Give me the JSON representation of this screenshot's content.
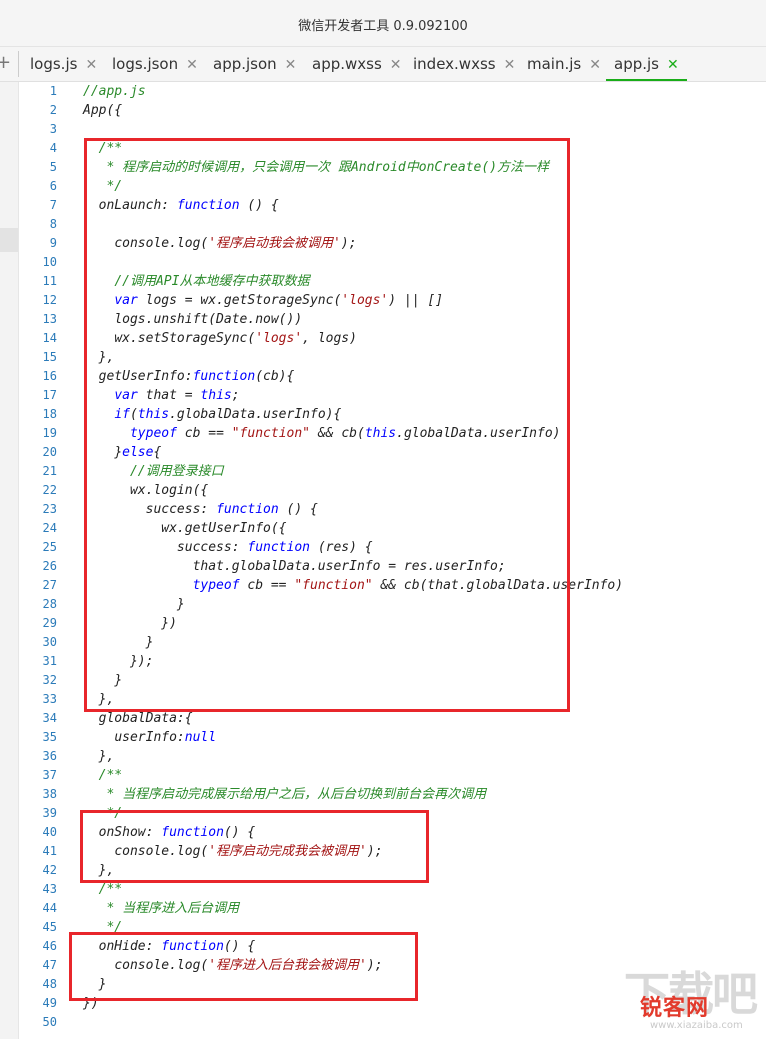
{
  "window": {
    "title": "微信开发者工具 0.9.092100"
  },
  "toolbar": {
    "add_tab_label": "+"
  },
  "tabs": [
    {
      "label": "logs.js",
      "close": "✕",
      "active": false
    },
    {
      "label": "logs.json",
      "close": "✕",
      "active": false
    },
    {
      "label": "app.json",
      "close": "✕",
      "active": false
    },
    {
      "label": "app.wxss",
      "close": "✕",
      "active": false
    },
    {
      "label": "index.wxss",
      "close": "✕",
      "active": false
    },
    {
      "label": "main.js",
      "close": "✕",
      "active": false
    },
    {
      "label": "app.js",
      "close": "✕",
      "active": true
    }
  ],
  "editor": {
    "lines": [
      {
        "n": "1",
        "indent": "",
        "segs": [
          [
            "//app.js",
            "comment"
          ]
        ]
      },
      {
        "n": "2",
        "indent": "",
        "segs": [
          [
            "App({",
            "plain"
          ]
        ]
      },
      {
        "n": "3",
        "indent": "",
        "segs": []
      },
      {
        "n": "4",
        "indent": "  ",
        "segs": [
          [
            "/**",
            "comment"
          ]
        ]
      },
      {
        "n": "5",
        "indent": "   ",
        "segs": [
          [
            "* 程序启动的时候调用，只会调用一次 跟Android中onCreate()方法一样",
            "comment"
          ]
        ]
      },
      {
        "n": "6",
        "indent": "   ",
        "segs": [
          [
            "*/",
            "comment"
          ]
        ]
      },
      {
        "n": "7",
        "indent": "  ",
        "segs": [
          [
            "onLaunch: ",
            "plain"
          ],
          [
            "function",
            "kw"
          ],
          [
            " () {",
            "plain"
          ]
        ]
      },
      {
        "n": "8",
        "indent": "",
        "segs": []
      },
      {
        "n": "9",
        "indent": "    ",
        "segs": [
          [
            "console.log(",
            "plain"
          ],
          [
            "'程序启动我会被调用'",
            "str"
          ],
          [
            ");",
            "plain"
          ]
        ]
      },
      {
        "n": "10",
        "indent": "",
        "segs": []
      },
      {
        "n": "11",
        "indent": "    ",
        "segs": [
          [
            "//调用API从本地缓存中获取数据",
            "comment"
          ]
        ]
      },
      {
        "n": "12",
        "indent": "    ",
        "segs": [
          [
            "var",
            "kw"
          ],
          [
            " logs = wx.getStorageSync(",
            "plain"
          ],
          [
            "'logs'",
            "str"
          ],
          [
            ") || []",
            "plain"
          ]
        ]
      },
      {
        "n": "13",
        "indent": "    ",
        "segs": [
          [
            "logs.unshift(Date.now())",
            "plain"
          ]
        ]
      },
      {
        "n": "14",
        "indent": "    ",
        "segs": [
          [
            "wx.setStorageSync(",
            "plain"
          ],
          [
            "'logs'",
            "str"
          ],
          [
            ", logs)",
            "plain"
          ]
        ]
      },
      {
        "n": "15",
        "indent": "  ",
        "segs": [
          [
            "},",
            "plain"
          ]
        ]
      },
      {
        "n": "16",
        "indent": "  ",
        "segs": [
          [
            "getUserInfo:",
            "plain"
          ],
          [
            "function",
            "kw"
          ],
          [
            "(cb){",
            "plain"
          ]
        ]
      },
      {
        "n": "17",
        "indent": "    ",
        "segs": [
          [
            "var",
            "kw"
          ],
          [
            " that = ",
            "plain"
          ],
          [
            "this",
            "kw"
          ],
          [
            ";",
            "plain"
          ]
        ]
      },
      {
        "n": "18",
        "indent": "    ",
        "segs": [
          [
            "if",
            "kw"
          ],
          [
            "(",
            "plain"
          ],
          [
            "this",
            "kw"
          ],
          [
            ".globalData.userInfo){",
            "plain"
          ]
        ]
      },
      {
        "n": "19",
        "indent": "      ",
        "segs": [
          [
            "typeof",
            "kw"
          ],
          [
            " cb == ",
            "plain"
          ],
          [
            "\"function\"",
            "str"
          ],
          [
            " && cb(",
            "plain"
          ],
          [
            "this",
            "kw"
          ],
          [
            ".globalData.userInfo)",
            "plain"
          ]
        ]
      },
      {
        "n": "20",
        "indent": "    ",
        "segs": [
          [
            "}",
            "plain"
          ],
          [
            "else",
            "kw"
          ],
          [
            "{",
            "plain"
          ]
        ]
      },
      {
        "n": "21",
        "indent": "      ",
        "segs": [
          [
            "//调用登录接口",
            "comment"
          ]
        ]
      },
      {
        "n": "22",
        "indent": "      ",
        "segs": [
          [
            "wx.login({",
            "plain"
          ]
        ]
      },
      {
        "n": "23",
        "indent": "        ",
        "segs": [
          [
            "success: ",
            "plain"
          ],
          [
            "function",
            "kw"
          ],
          [
            " () {",
            "plain"
          ]
        ]
      },
      {
        "n": "24",
        "indent": "          ",
        "segs": [
          [
            "wx.getUserInfo({",
            "plain"
          ]
        ]
      },
      {
        "n": "25",
        "indent": "            ",
        "segs": [
          [
            "success: ",
            "plain"
          ],
          [
            "function",
            "kw"
          ],
          [
            " (res) {",
            "plain"
          ]
        ]
      },
      {
        "n": "26",
        "indent": "              ",
        "segs": [
          [
            "that.globalData.userInfo = res.userInfo;",
            "plain"
          ]
        ]
      },
      {
        "n": "27",
        "indent": "              ",
        "segs": [
          [
            "typeof",
            "kw"
          ],
          [
            " cb == ",
            "plain"
          ],
          [
            "\"function\"",
            "str"
          ],
          [
            " && cb(that.globalData.userInfo)",
            "plain"
          ]
        ]
      },
      {
        "n": "28",
        "indent": "            ",
        "segs": [
          [
            "}",
            "plain"
          ]
        ]
      },
      {
        "n": "29",
        "indent": "          ",
        "segs": [
          [
            "})",
            "plain"
          ]
        ]
      },
      {
        "n": "30",
        "indent": "        ",
        "segs": [
          [
            "}",
            "plain"
          ]
        ]
      },
      {
        "n": "31",
        "indent": "      ",
        "segs": [
          [
            "});",
            "plain"
          ]
        ]
      },
      {
        "n": "32",
        "indent": "    ",
        "segs": [
          [
            "}",
            "plain"
          ]
        ]
      },
      {
        "n": "33",
        "indent": "  ",
        "segs": [
          [
            "},",
            "plain"
          ]
        ]
      },
      {
        "n": "34",
        "indent": "  ",
        "segs": [
          [
            "globalData:{",
            "plain"
          ]
        ]
      },
      {
        "n": "35",
        "indent": "    ",
        "segs": [
          [
            "userInfo:",
            "plain"
          ],
          [
            "null",
            "kw"
          ]
        ]
      },
      {
        "n": "36",
        "indent": "  ",
        "segs": [
          [
            "},",
            "plain"
          ]
        ]
      },
      {
        "n": "37",
        "indent": "  ",
        "segs": [
          [
            "/**",
            "comment"
          ]
        ]
      },
      {
        "n": "38",
        "indent": "   ",
        "segs": [
          [
            "* 当程序启动完成展示给用户之后，从后台切换到前台会再次调用",
            "comment"
          ]
        ]
      },
      {
        "n": "39",
        "indent": "   ",
        "segs": [
          [
            "*/",
            "comment"
          ]
        ]
      },
      {
        "n": "40",
        "indent": "  ",
        "segs": [
          [
            "onShow: ",
            "plain"
          ],
          [
            "function",
            "kw"
          ],
          [
            "() {",
            "plain"
          ]
        ]
      },
      {
        "n": "41",
        "indent": "    ",
        "segs": [
          [
            "console.log(",
            "plain"
          ],
          [
            "'程序启动完成我会被调用'",
            "str"
          ],
          [
            ");",
            "plain"
          ]
        ]
      },
      {
        "n": "42",
        "indent": "  ",
        "segs": [
          [
            "},",
            "plain"
          ]
        ]
      },
      {
        "n": "43",
        "indent": "  ",
        "segs": [
          [
            "/**",
            "comment"
          ]
        ]
      },
      {
        "n": "44",
        "indent": "   ",
        "segs": [
          [
            "* 当程序进入后台调用",
            "comment"
          ]
        ]
      },
      {
        "n": "45",
        "indent": "   ",
        "segs": [
          [
            "*/",
            "comment"
          ]
        ]
      },
      {
        "n": "46",
        "indent": "  ",
        "segs": [
          [
            "onHide: ",
            "plain"
          ],
          [
            "function",
            "kw"
          ],
          [
            "() {",
            "plain"
          ]
        ]
      },
      {
        "n": "47",
        "indent": "    ",
        "segs": [
          [
            "console.log(",
            "plain"
          ],
          [
            "'程序进入后台我会被调用'",
            "str"
          ],
          [
            ");",
            "plain"
          ]
        ]
      },
      {
        "n": "48",
        "indent": "  ",
        "segs": [
          [
            "}",
            "plain"
          ]
        ]
      },
      {
        "n": "49",
        "indent": "",
        "segs": [
          [
            "})",
            "plain"
          ]
        ]
      },
      {
        "n": "50",
        "indent": "",
        "segs": []
      }
    ]
  },
  "annotation_color": "#e8262b",
  "watermark": {
    "big_text": "下载吧",
    "brand_text": "锐客网",
    "site_text": "www.xiazaiba.com"
  }
}
